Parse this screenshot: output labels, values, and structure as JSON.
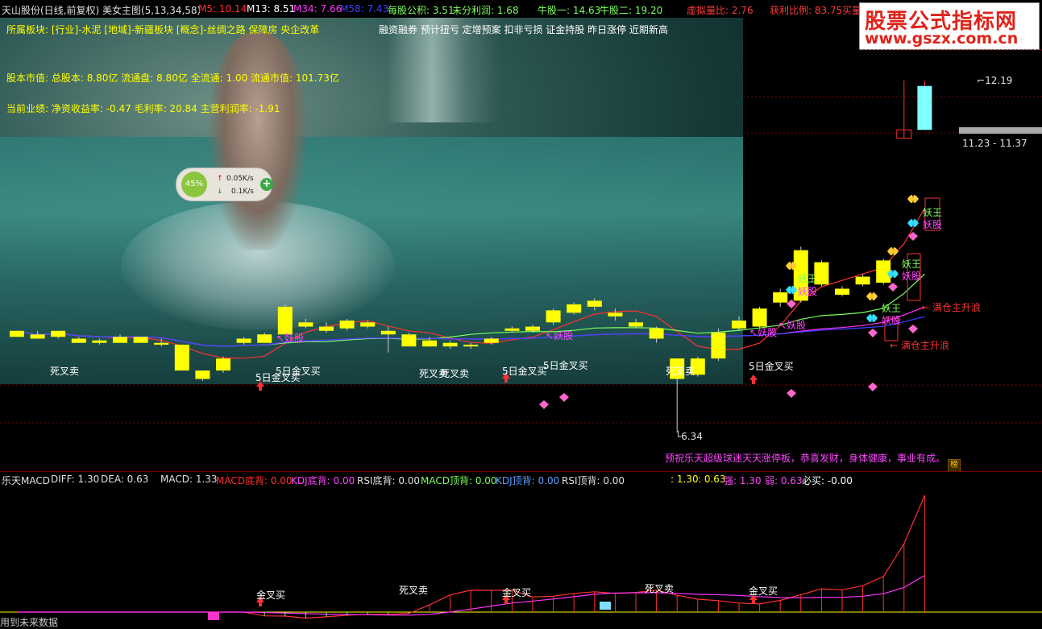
{
  "header": {
    "title": "天山股份(日线,前复权) 美女主图(5,13,34,58)",
    "ma5": "M5: 10.14",
    "ma13": "M13: 8.51",
    "ma34": "M34: 7.66",
    "ma58": "M58: 7.43",
    "eps_fund": "每股公积: 3.51",
    "undistributed": "未分利润: 1.68",
    "bull1": "牛股一: 14.63",
    "bull2": "牛股二: 19.20",
    "virtual_vol": "虚拟量比: 2.76",
    "profit_ratio": "获利比例: 83.75",
    "buy_cut": "买量",
    "colors": {
      "ma5": "#ff3030",
      "ma13": "#ffffff",
      "ma34": "#ff33ff",
      "ma58": "#3030ff",
      "fund": "#7cff5c",
      "red": "#ff3b3b"
    }
  },
  "logo": {
    "title": "股票公式指标网",
    "url": "www.gszx.com.cn"
  },
  "info": {
    "sector": "所属板块: [行业]-水泥 [地域]-新疆板块 [概念]-丝绸之路 保障房 央企改革",
    "tags": "融资融券 预计扭亏 定增预案 扣非亏损 证金持股 昨日涨停 近期新高",
    "capital": "股本市值: 总股本: 8.80亿 流通盘: 8.80亿 全流通: 1.00 流通市值: 101.73亿",
    "perf": "当前业绩: 净资收益率: -0.47 毛利率: 20.84 主营利润率: -1.91"
  },
  "speed": {
    "pct": "45%",
    "up": "0.05K/s",
    "down": "0.1K/s"
  },
  "price_labels": {
    "high": "12.19",
    "range": "11.23 - 11.37",
    "low": "6.34"
  },
  "greeting": "预祝乐天超级球迷天天涨停板，恭喜发财，身体健康，事业有成。",
  "badge": "榜",
  "indicator": {
    "name": "乐天MACD",
    "diff": "DIFF: 1.30",
    "dea": "DEA: 0.63",
    "macd": "MACD: 1.33",
    "macd_bottom": "MACD底背: 0.00",
    "kdj_bottom": "KDJ底背: 0.00",
    "rsi_bottom": "RSI底背: 0.00",
    "macd_top": "MACD顶背: 0.00",
    "kdj_top": "KDJ顶背: 0.00",
    "rsi_top": "RSI顶背: 0.00",
    "v1": ": 1.30",
    "v2": ": 0.63",
    "strong": "强: 1.30",
    "weak": "弱: 0.63",
    "must_buy": "必买: -0.00"
  },
  "footer": "用到未来数据",
  "annotations": {
    "death_cross": "死叉卖",
    "golden5": "5日金叉买",
    "golden": "金叉买",
    "demon": "妖股",
    "demon_king": "妖王",
    "bottom": "底部",
    "full_main": "满仓主升浪",
    "strong_break": "강势突破",
    "buy_signal": "主升浪"
  },
  "chart_data": {
    "type": "candlestick",
    "title": "天山股份(日线,前复权)",
    "candles": [
      {
        "o": 7.93,
        "c": 8.03,
        "h": 8.03,
        "l": 7.93
      },
      {
        "o": 7.97,
        "c": 7.9,
        "h": 8.03,
        "l": 7.9
      },
      {
        "o": 7.93,
        "c": 8.03,
        "h": 8.03,
        "l": 7.9
      },
      {
        "o": 7.9,
        "c": 7.83,
        "h": 7.93,
        "l": 7.83
      },
      {
        "o": 7.83,
        "c": 7.87,
        "h": 7.9,
        "l": 7.8
      },
      {
        "o": 7.83,
        "c": 7.93,
        "h": 7.97,
        "l": 7.83
      },
      {
        "o": 7.83,
        "c": 7.93,
        "h": 7.93,
        "l": 7.83
      },
      {
        "o": 7.83,
        "c": 7.8,
        "h": 7.9,
        "l": 7.77
      },
      {
        "o": 7.8,
        "c": 7.37,
        "h": 7.8,
        "l": 7.37
      },
      {
        "o": 7.37,
        "c": 7.23,
        "h": 7.37,
        "l": 7.2
      },
      {
        "o": 7.37,
        "c": 7.57,
        "h": 7.6,
        "l": 7.33
      },
      {
        "o": 7.83,
        "c": 7.9,
        "h": 7.93,
        "l": 7.8
      },
      {
        "o": 7.83,
        "c": 7.97,
        "h": 8.0,
        "l": 7.83
      },
      {
        "o": 7.97,
        "c": 8.43,
        "h": 8.47,
        "l": 7.97
      },
      {
        "o": 8.1,
        "c": 8.17,
        "h": 8.23,
        "l": 8.07
      },
      {
        "o": 8.1,
        "c": 8.03,
        "h": 8.17,
        "l": 8.0
      },
      {
        "o": 8.07,
        "c": 8.2,
        "h": 8.23,
        "l": 8.03
      },
      {
        "o": 8.1,
        "c": 8.17,
        "h": 8.2,
        "l": 8.07
      },
      {
        "o": 8.03,
        "c": 7.97,
        "h": 8.1,
        "l": 7.67
      },
      {
        "o": 7.97,
        "c": 7.77,
        "h": 8.0,
        "l": 7.77
      },
      {
        "o": 7.77,
        "c": 7.87,
        "h": 7.93,
        "l": 7.77
      },
      {
        "o": 7.83,
        "c": 7.77,
        "h": 7.87,
        "l": 7.73
      },
      {
        "o": 7.77,
        "c": 7.8,
        "h": 7.83,
        "l": 7.73
      },
      {
        "o": 7.83,
        "c": 7.9,
        "h": 7.93,
        "l": 7.8
      },
      {
        "o": 8.03,
        "c": 8.07,
        "h": 8.1,
        "l": 8.0
      },
      {
        "o": 8.03,
        "c": 8.1,
        "h": 8.13,
        "l": 8.0
      },
      {
        "o": 8.17,
        "c": 8.37,
        "h": 8.4,
        "l": 8.13
      },
      {
        "o": 8.33,
        "c": 8.47,
        "h": 8.5,
        "l": 8.3
      },
      {
        "o": 8.43,
        "c": 8.53,
        "h": 8.57,
        "l": 8.37
      },
      {
        "o": 8.33,
        "c": 8.27,
        "h": 8.4,
        "l": 8.2
      },
      {
        "o": 8.1,
        "c": 8.17,
        "h": 8.23,
        "l": 8.07
      },
      {
        "o": 8.07,
        "c": 7.9,
        "h": 8.1,
        "l": 7.83
      },
      {
        "o": 7.57,
        "c": 7.23,
        "h": 7.57,
        "l": 6.34
      },
      {
        "o": 7.57,
        "c": 7.3,
        "h": 7.6,
        "l": 7.27
      },
      {
        "o": 7.57,
        "c": 8.0,
        "h": 8.07,
        "l": 7.53
      },
      {
        "o": 8.07,
        "c": 8.2,
        "h": 8.27,
        "l": 8.03
      },
      {
        "o": 8.1,
        "c": 8.4,
        "h": 8.43,
        "l": 8.07
      },
      {
        "o": 8.5,
        "c": 8.67,
        "h": 8.73,
        "l": 8.43
      },
      {
        "o": 8.53,
        "c": 9.37,
        "h": 9.43,
        "l": 8.5
      },
      {
        "o": 8.8,
        "c": 9.17,
        "h": 9.2,
        "l": 8.77
      },
      {
        "o": 8.63,
        "c": 8.73,
        "h": 8.77,
        "l": 8.6
      },
      {
        "o": 8.8,
        "c": 8.93,
        "h": 8.97,
        "l": 8.77
      },
      {
        "o": 8.83,
        "c": 9.2,
        "h": 9.23,
        "l": 8.8
      },
      {
        "o": 11.23,
        "c": 11.37,
        "h": 12.19,
        "l": 11.23
      },
      {
        "o": 11.37,
        "c": 12.1,
        "h": 12.19,
        "l": 11.37
      }
    ],
    "price_marks": {
      "max": 12.19,
      "min": 6.34
    }
  }
}
